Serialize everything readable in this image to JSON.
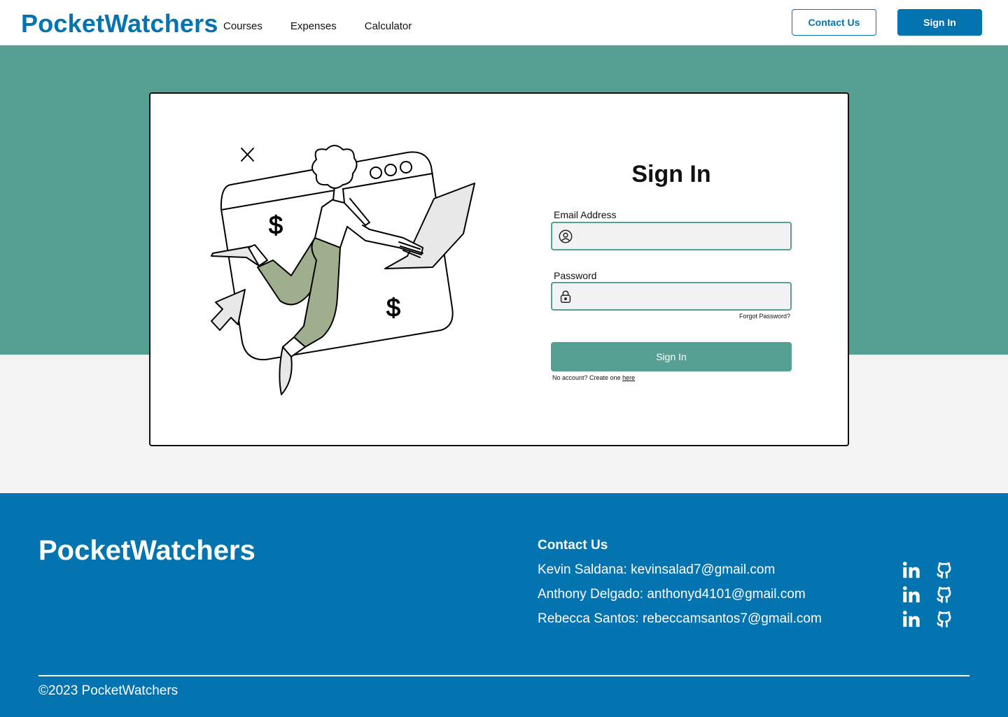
{
  "header": {
    "logo": "PocketWatchers",
    "nav": [
      "Courses",
      "Expenses",
      "Calculator"
    ],
    "contact_label": "Contact Us",
    "signin_label": "Sign In"
  },
  "form": {
    "title": "Sign In",
    "email_label": "Email Address",
    "password_label": "Password",
    "forgot": "Forgot Password?",
    "submit": "Sign In",
    "no_account": "No account? Create one ",
    "here": "here"
  },
  "footer": {
    "logo": "PocketWatchers",
    "contact_title": "Contact Us",
    "contacts": [
      "Kevin Saldana: kevinsalad7@gmail.com",
      "Anthony Delgado: anthonyd4101@gmail.com",
      "Rebecca Santos: rebeccamsantos7@gmail.com"
    ],
    "copyright": "©2023 PocketWatchers"
  },
  "colors": {
    "brand_blue": "#0474b0",
    "teal": "#56a093",
    "pants_green": "#9fae8d",
    "background": "#f3f3f3"
  },
  "icons": [
    "user-circle-icon",
    "lock-icon",
    "linkedin-icon",
    "github-icon"
  ]
}
